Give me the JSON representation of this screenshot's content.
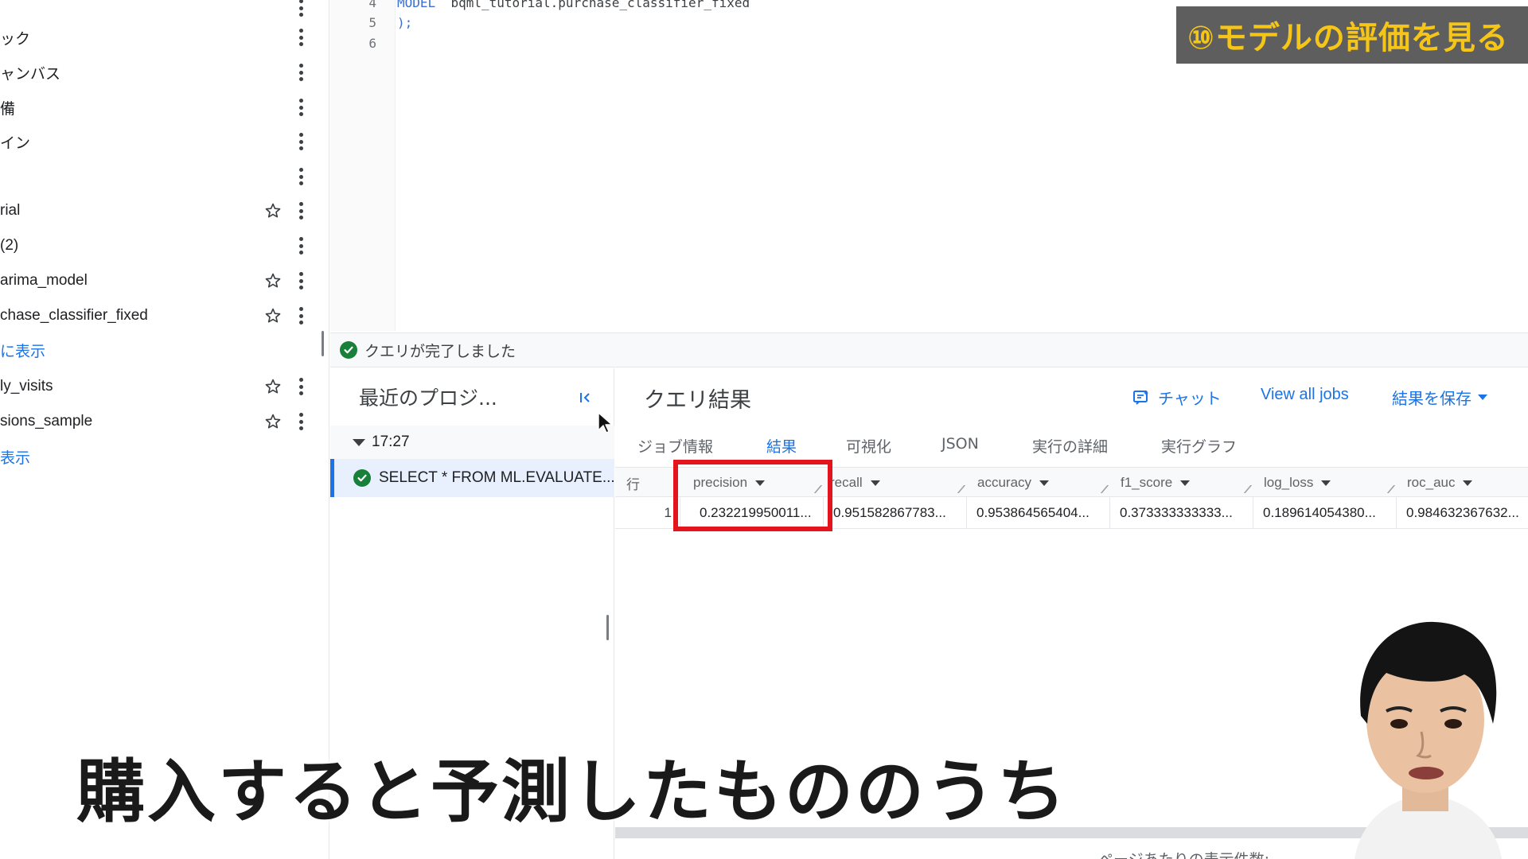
{
  "overlay": {
    "title": "⑩モデルの評価を見る"
  },
  "explorer": {
    "rows": [
      {
        "label": "ック",
        "star": false
      },
      {
        "label": "ャンバス",
        "star": false
      },
      {
        "label": "備",
        "star": false
      },
      {
        "label": "イン",
        "star": false
      },
      {
        "label": "",
        "star": false
      },
      {
        "label": "rial",
        "star": true
      },
      {
        "label": "(2)",
        "star": false
      },
      {
        "label": "arima_model",
        "star": true
      },
      {
        "label": "chase_classifier_fixed",
        "star": true
      },
      {
        "label": "に表示",
        "link": true
      },
      {
        "label": "ly_visits",
        "star": true
      },
      {
        "label": "sions_sample",
        "star": true
      },
      {
        "label": "表示",
        "link": true
      }
    ]
  },
  "editor": {
    "lines": [
      {
        "num": "4",
        "keyword": "MODEL",
        "text": "bqml_tutorial.purchase_classifier_fixed"
      },
      {
        "num": "5",
        "text": ");"
      },
      {
        "num": "6",
        "text": ""
      }
    ]
  },
  "status": {
    "text": "クエリが完了しました"
  },
  "history": {
    "title": "最近のプロジ...",
    "group_time": "17:27",
    "item_text": "SELECT * FROM ML.EVALUATE..."
  },
  "results": {
    "title": "クエリ結果",
    "actions": {
      "chat": "チャット",
      "view_all_jobs": "View all jobs",
      "save": "結果を保存"
    },
    "tabs": [
      "ジョブ情報",
      "結果",
      "可視化",
      "JSON",
      "実行の詳細",
      "実行グラフ"
    ],
    "active_tab": "結果",
    "row_header": "行",
    "columns": [
      "precision",
      "recall",
      "accuracy",
      "f1_score",
      "log_loss",
      "roc_auc"
    ],
    "rows": [
      {
        "row": "1",
        "values": [
          "0.232219950011...",
          "0.951582867783...",
          "0.953864565404...",
          "0.373333333333...",
          "0.189614054380...",
          "0.984632367632..."
        ]
      }
    ],
    "pager": "ページあたりの表示件数:"
  },
  "subtitle": "購入すると予測したもののうち",
  "colors": {
    "accent": "#1a73e8",
    "success": "#188038",
    "highlight": "#e4141e",
    "overlay_text": "#f5c518"
  }
}
